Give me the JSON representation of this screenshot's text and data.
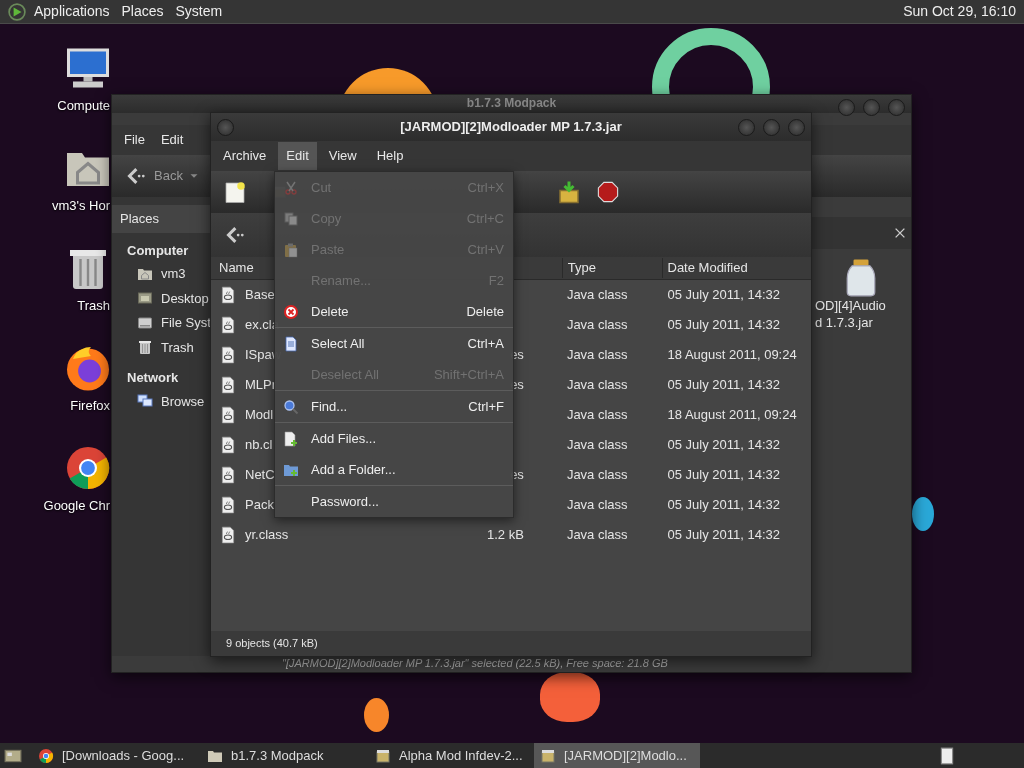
{
  "top_panel": {
    "menus": [
      "Applications",
      "Places",
      "System"
    ],
    "clock": "Sun Oct 29, 16:10"
  },
  "desktop_icons": [
    {
      "kind": "computer",
      "label": "Compute"
    },
    {
      "kind": "home",
      "label": "vm3's Hor"
    },
    {
      "kind": "trash",
      "label": "Trash"
    },
    {
      "kind": "firefox",
      "label": "Firefox"
    },
    {
      "kind": "chrome",
      "label": "Google Chr"
    }
  ],
  "file_manager": {
    "title": "b1.7.3 Modpack",
    "menus": [
      "File",
      "Edit"
    ],
    "back_button": "Back",
    "sidebar_header": "Places",
    "sections": [
      {
        "title": "Computer",
        "items": [
          {
            "kind": "home",
            "label": "vm3"
          },
          {
            "kind": "desktop",
            "label": "Desktop"
          },
          {
            "kind": "drive",
            "label": "File Syst"
          },
          {
            "kind": "trash",
            "label": "Trash"
          }
        ]
      },
      {
        "title": "Network",
        "items": [
          {
            "kind": "network",
            "label": "Browse"
          }
        ]
      }
    ],
    "file_label_lines": [
      "OD][4]Audio",
      "d 1.7.3.jar"
    ],
    "status": "\"[JARMOD][2]Modloader MP 1.7.3.jar\" selected (22.5 kB), Free space: 21.8 GB"
  },
  "archive_manager": {
    "title": "[JARMOD][2]Modloader MP 1.7.3.jar",
    "menus": [
      {
        "label": "Archive",
        "selected": false
      },
      {
        "label": "Edit",
        "selected": true
      },
      {
        "label": "View",
        "selected": false
      },
      {
        "label": "Help",
        "selected": false
      }
    ],
    "columns": [
      "Name",
      "Type",
      "Date Modified"
    ],
    "rows": [
      {
        "name": "Base",
        "type": "Java class",
        "date": "05 July 2011, 14:32"
      },
      {
        "name": "ex.cla",
        "type": "Java class",
        "date": "05 July 2011, 14:32"
      },
      {
        "name": "ISpaw",
        "size": "es",
        "type": "Java class",
        "date": "18 August 2011, 09:24"
      },
      {
        "name": "MLPr",
        "size": "es",
        "type": "Java class",
        "date": "05 July 2011, 14:32"
      },
      {
        "name": "Modl",
        "type": "Java class",
        "date": "18 August 2011, 09:24"
      },
      {
        "name": "nb.cl",
        "type": "Java class",
        "date": "05 July 2011, 14:32"
      },
      {
        "name": "NetC",
        "size": "es",
        "type": "Java class",
        "date": "05 July 2011, 14:32"
      },
      {
        "name": "Pack",
        "type": "Java class",
        "date": "05 July 2011, 14:32"
      },
      {
        "name": "yr.class",
        "size": "1.2 kB",
        "type": "Java class",
        "date": "05 July 2011, 14:32"
      }
    ],
    "status": "9 objects (40.7 kB)"
  },
  "edit_menu": [
    {
      "kind": "item",
      "label": "Cut",
      "shortcut": "Ctrl+X",
      "disabled": true
    },
    {
      "kind": "item",
      "label": "Copy",
      "shortcut": "Ctrl+C",
      "disabled": true
    },
    {
      "kind": "item",
      "label": "Paste",
      "shortcut": "Ctrl+V",
      "disabled": true
    },
    {
      "kind": "item",
      "label": "Rename...",
      "shortcut": "F2",
      "disabled": true
    },
    {
      "kind": "item",
      "label": "Delete",
      "shortcut": "Delete",
      "disabled": false
    },
    {
      "kind": "separator"
    },
    {
      "kind": "item",
      "label": "Select All",
      "shortcut": "Ctrl+A",
      "disabled": false
    },
    {
      "kind": "item",
      "label": "Deselect All",
      "shortcut": "Shift+Ctrl+A",
      "disabled": true
    },
    {
      "kind": "separator"
    },
    {
      "kind": "item",
      "label": "Find...",
      "shortcut": "Ctrl+F",
      "disabled": false
    },
    {
      "kind": "separator"
    },
    {
      "kind": "item",
      "label": "Add Files...",
      "disabled": false
    },
    {
      "kind": "item",
      "label": "Add a Folder...",
      "disabled": false
    },
    {
      "kind": "separator"
    },
    {
      "kind": "item",
      "label": "Password...",
      "disabled": false
    }
  ],
  "taskbar": [
    {
      "label": "[Downloads - Goog...",
      "selected": false
    },
    {
      "label": "b1.7.3 Modpack",
      "selected": false
    },
    {
      "label": "Alpha Mod Infdev-2...",
      "selected": false
    },
    {
      "label": "[JARMOD][2]Modlo...",
      "selected": true
    }
  ]
}
